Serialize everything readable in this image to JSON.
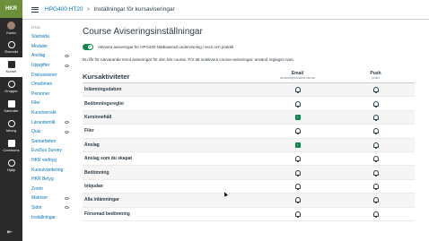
{
  "global_nav": {
    "logo": "HKR",
    "items": [
      {
        "label": "Konto",
        "icon": "avatar"
      },
      {
        "label": "Översikt",
        "icon": "dashboard-icon"
      },
      {
        "label": "Kurser",
        "icon": "courses-icon",
        "active": true
      },
      {
        "label": "Grupper",
        "icon": "groups-icon"
      },
      {
        "label": "Kalender",
        "icon": "calendar-icon"
      },
      {
        "label": "Inkorg",
        "icon": "inbox-icon"
      },
      {
        "label": "Commons",
        "icon": "commons-icon"
      },
      {
        "label": "Hjälp",
        "icon": "help-icon"
      }
    ]
  },
  "header": {
    "course": "HPG400 HT20",
    "separator": ">",
    "page": "Inställningar för kursaviseringar"
  },
  "course_nav": {
    "term": "HT20",
    "items": [
      {
        "label": "Startsida",
        "hidden_icon": false
      },
      {
        "label": "Moduler",
        "hidden_icon": false
      },
      {
        "label": "Anslag",
        "hidden_icon": true
      },
      {
        "label": "Uppgifter",
        "hidden_icon": true
      },
      {
        "label": "Diskussioner",
        "hidden_icon": false
      },
      {
        "label": "Omdömen",
        "hidden_icon": false
      },
      {
        "label": "Personer",
        "hidden_icon": false
      },
      {
        "label": "Filer",
        "hidden_icon": false
      },
      {
        "label": "Kursöversikt",
        "hidden_icon": false
      },
      {
        "label": "Lärandemål",
        "hidden_icon": true
      },
      {
        "label": "Quiz",
        "hidden_icon": true
      },
      {
        "label": "Samarbeten",
        "hidden_icon": false
      },
      {
        "label": "EvaSys Survey",
        "hidden_icon": false
      },
      {
        "label": "HKR verktyg",
        "hidden_icon": false
      },
      {
        "label": "Kursutvärdering",
        "hidden_icon": false
      },
      {
        "label": "HKR Betyg",
        "hidden_icon": false
      },
      {
        "label": "Zoom",
        "hidden_icon": false
      },
      {
        "label": "Matriser",
        "hidden_icon": true
      },
      {
        "label": "Sidor",
        "hidden_icon": true
      },
      {
        "label": "Inställningar",
        "hidden_icon": false
      }
    ]
  },
  "main": {
    "title": "Course Aviseringsinställningar",
    "toggle_label": "Aktivera aviseringar för HPG400 Nätbaserad undervisning i teori och praktik",
    "description": "Du får för närvarande emot aviseringar för den här course. För att inaktivera course-aviseringar, använd reglaget ovan.",
    "table": {
      "title": "Kursaktiviteter",
      "col_email": "Email",
      "col_email_sub": "asukori@student.hkr.se",
      "col_push": "Push",
      "col_push_sub": "push",
      "rows": [
        {
          "name": "Inlämningsdatum",
          "email": "bell",
          "push": "bell"
        },
        {
          "name": "Bedömningsregler",
          "email": "bell",
          "push": "bell"
        },
        {
          "name": "Kursinnehåll",
          "email": "immediate",
          "push": "bell"
        },
        {
          "name": "Filer",
          "email": "bell",
          "push": "bell"
        },
        {
          "name": "Anslag",
          "email": "immediate",
          "push": "bell"
        },
        {
          "name": "Anslag som du skapat",
          "email": "bell",
          "push": "bell"
        },
        {
          "name": "Bedömning",
          "email": "bell",
          "push": "bell"
        },
        {
          "name": "Inbjudan",
          "email": "bell",
          "push": "bell"
        },
        {
          "name": "Alla inlämningar",
          "email": "bell",
          "push": "bell"
        },
        {
          "name": "Försenad bedömning",
          "email": "bell",
          "push": "bell"
        }
      ]
    }
  },
  "colors": {
    "accent": "#0374b5",
    "success": "#0b874b",
    "nav_bg": "#2a2a2a"
  }
}
